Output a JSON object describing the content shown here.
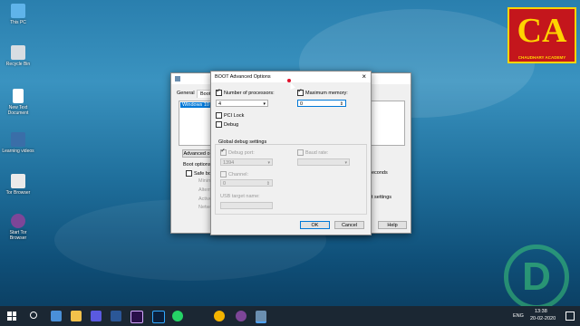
{
  "desktop": {
    "icons": [
      {
        "label": "This PC"
      },
      {
        "label": "Recycle Bin"
      },
      {
        "label": "New Text Document"
      },
      {
        "label": "Learning videos"
      },
      {
        "label": "Tor Browser"
      },
      {
        "label": "Start Tor Browser"
      }
    ]
  },
  "logo": {
    "letters": "CA",
    "subtitle": "CHAUDHARY ACADEMY"
  },
  "bg_window": {
    "tabs": [
      "General",
      "Boot"
    ],
    "list_item": "Windows 10 (C",
    "advanced_button": "Advanced o",
    "boot_options_label": "Boot options",
    "safe_boot": "Safe boo",
    "sub_options": [
      "Minim",
      "Altern",
      "Active",
      "Netwo"
    ],
    "seconds_suffix": "econds",
    "settings_suffix": "t settings",
    "help_button": "Help"
  },
  "dialog": {
    "title": "BOOT Advanced Options",
    "num_processors_label": "Number of processors:",
    "num_processors_value": "4",
    "max_memory_label": "Maximum memory:",
    "max_memory_value": "0",
    "pci_lock": "PCI Lock",
    "debug": "Debug",
    "global_debug_label": "Global debug settings",
    "debug_port_label": "Debug port:",
    "debug_port_value": "1394",
    "baud_rate_label": "Baud rate:",
    "baud_rate_value": "",
    "channel_label": "Channel:",
    "channel_value": "0",
    "usb_target_label": "USB target name:",
    "usb_target_value": "",
    "ok": "OK",
    "cancel": "Cancel"
  },
  "taskbar": {
    "language": "ENG",
    "time": "13:38",
    "date": "20-02-2020"
  }
}
